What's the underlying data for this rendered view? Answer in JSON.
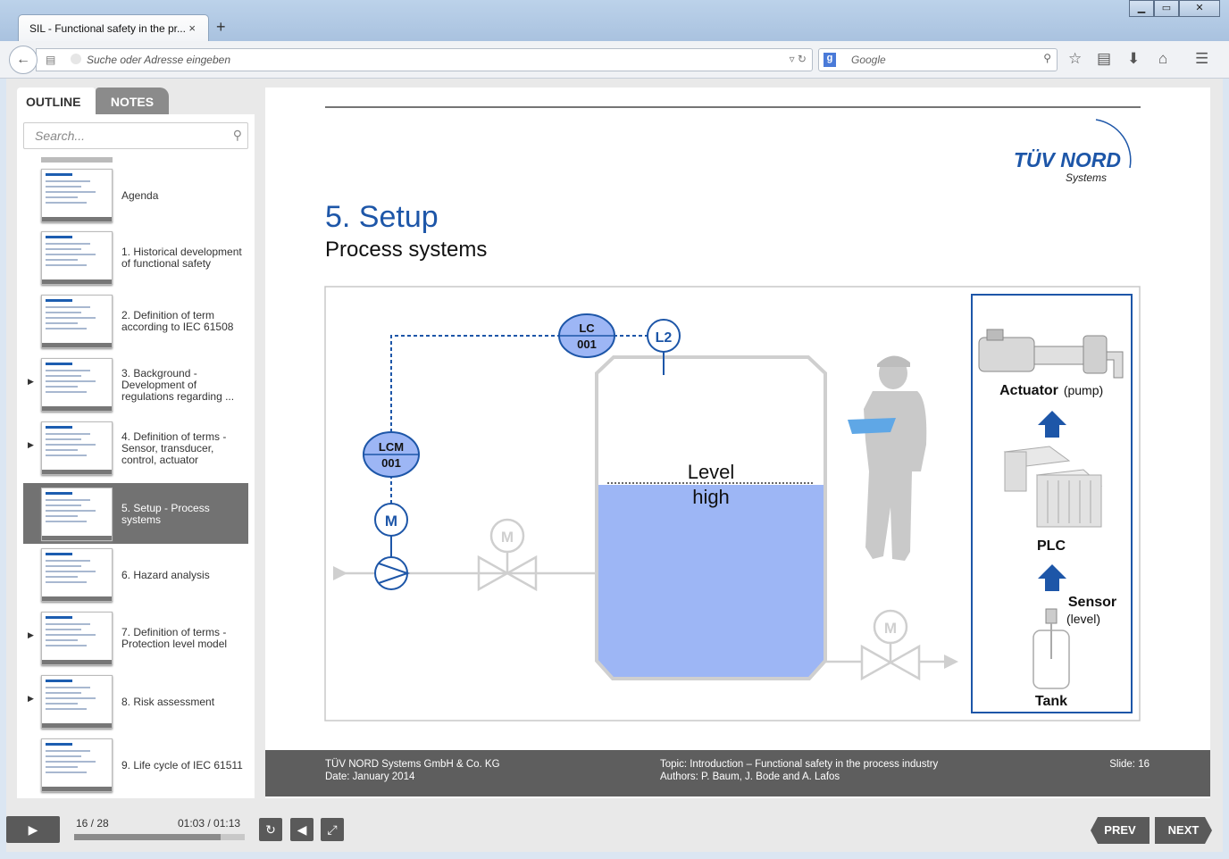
{
  "browser": {
    "tab_title": "SIL - Functional safety in the pr...",
    "tab_close": "×",
    "new_tab": "+",
    "url_placeholder": "Suche oder Adresse eingeben",
    "search_engine": "Google",
    "window_buttons": [
      "▁",
      "▭",
      "✕"
    ],
    "toolbar_icons": [
      "star-icon",
      "reading-list-icon",
      "download-icon",
      "home-icon",
      "menu-icon"
    ]
  },
  "sidebar": {
    "tabs": [
      "OUTLINE",
      "NOTES"
    ],
    "search_placeholder": "Search...",
    "items": [
      {
        "label": "Agenda",
        "has_children": false,
        "active": false
      },
      {
        "label": "1. Historical development of functional safety",
        "has_children": false,
        "active": false
      },
      {
        "label": "2. Definition of term according to IEC 61508",
        "has_children": false,
        "active": false
      },
      {
        "label": "3. Background - Development of regulations regarding ...",
        "has_children": true,
        "active": false
      },
      {
        "label": "4. Definition of terms - Sensor, transducer, control, actuator",
        "has_children": true,
        "active": false
      },
      {
        "label": "5. Setup - Process systems",
        "has_children": false,
        "active": true
      },
      {
        "label": "6. Hazard analysis",
        "has_children": false,
        "active": false
      },
      {
        "label": "7. Definition of terms - Protection level model",
        "has_children": true,
        "active": false
      },
      {
        "label": "8. Risk assessment",
        "has_children": true,
        "active": false
      },
      {
        "label": "9. Life cycle of IEC 61511",
        "has_children": false,
        "active": false
      }
    ]
  },
  "slide": {
    "logo_main": "TÜV NORD",
    "logo_sub": "Systems",
    "title": "5. Setup",
    "subtitle": "Process systems",
    "diagram": {
      "lc_top": "LC",
      "lc_bottom": "001",
      "l2": "L2",
      "lcm_top": "LCM",
      "lcm_bottom": "001",
      "motor": "M",
      "level_line1": "Level",
      "level_line2": "high",
      "actuator_label": "Actuator",
      "actuator_sub": "(pump)",
      "plc_label": "PLC",
      "sensor_label": "Sensor",
      "sensor_sub": "(level)",
      "tank_label": "Tank"
    },
    "footer": {
      "company": "TÜV NORD Systems GmbH & Co. KG",
      "date": "Date: January 2014",
      "topic": "Topic: Introduction – Functional safety in the process industry",
      "authors": "Authors: P. Baum, J. Bode and A. Lafos",
      "slide_no": "Slide: 16"
    }
  },
  "player": {
    "position": "16  / 28",
    "time": "01:03  / 01:13",
    "progress": 0.86,
    "prev": "PREV",
    "next": "NEXT"
  },
  "colors": {
    "accent_blue": "#1d56a8",
    "liquid": "#9db6f5",
    "dark_gray": "#5e5e5e"
  }
}
